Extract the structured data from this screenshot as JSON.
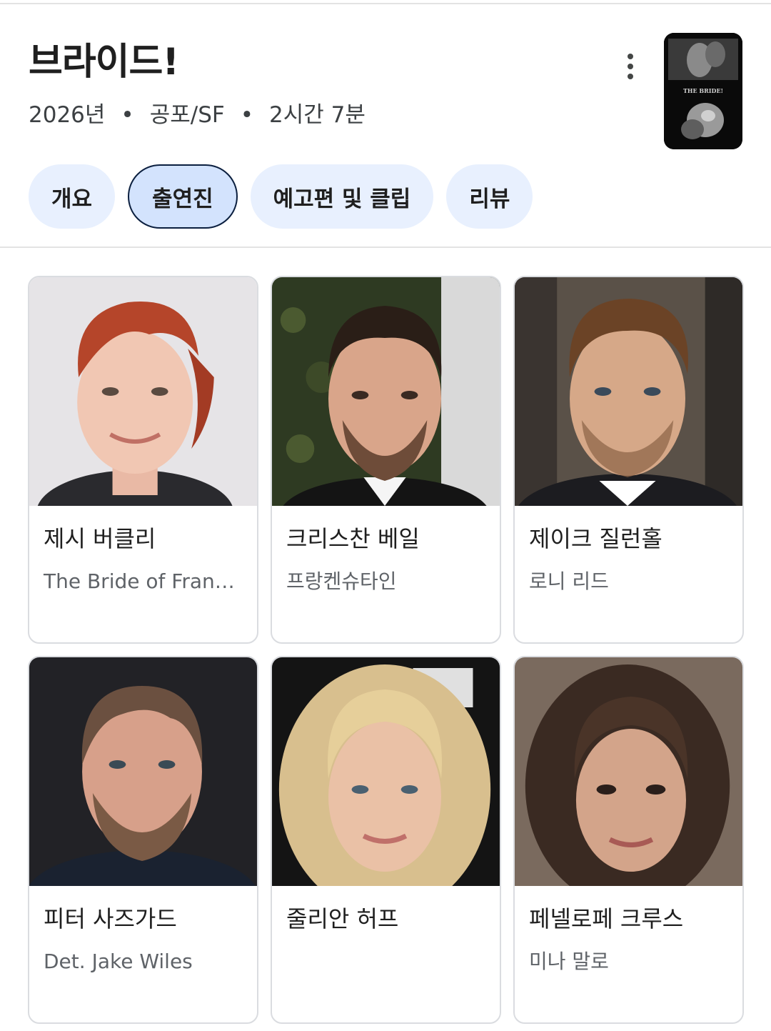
{
  "movie": {
    "title": "브라이드!",
    "year": "2026년",
    "genre": "공포/SF",
    "runtime": "2시간 7분",
    "separator": "•",
    "poster_text": "THE BRIDE!"
  },
  "tabs": [
    {
      "label": "개요",
      "active": false
    },
    {
      "label": "출연진",
      "active": true
    },
    {
      "label": "예고편 및 클립",
      "active": false
    },
    {
      "label": "리뷰",
      "active": false
    }
  ],
  "cast": [
    {
      "name": "제시 버클리",
      "role": "The Bride of Frank...",
      "photo": "actor-photo"
    },
    {
      "name": "크리스찬 베일",
      "role": "프랑켄슈타인",
      "photo": "actor-photo"
    },
    {
      "name": "제이크 질런홀",
      "role": "로니 리드",
      "photo": "actor-photo"
    },
    {
      "name": "피터 사즈가드",
      "role": "Det. Jake Wiles",
      "photo": "actor-photo"
    },
    {
      "name": "줄리안 허프",
      "role": "",
      "photo": "actor-photo"
    },
    {
      "name": "페넬로페 크루스",
      "role": "미나 말로",
      "photo": "actor-photo"
    }
  ],
  "colors": {
    "chip_bg": "#e8f0fe",
    "chip_active_bg": "#d3e3fd",
    "chip_active_border": "#0b1f3f"
  }
}
